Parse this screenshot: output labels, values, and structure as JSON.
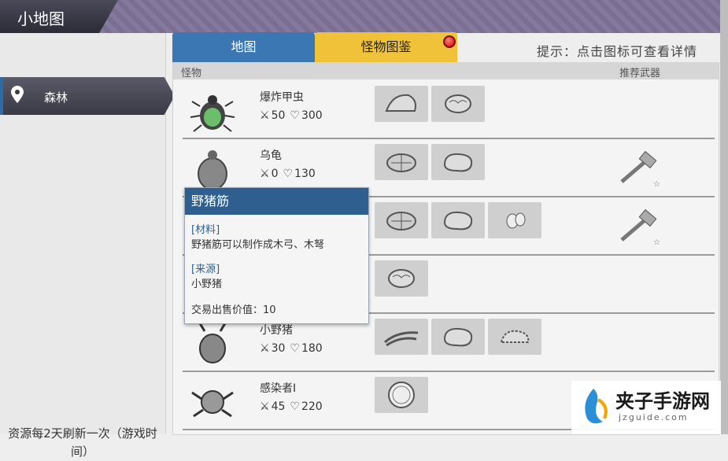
{
  "header": {
    "title": "小地图"
  },
  "left_panel": {
    "location": "森林",
    "refresh_note": "资源每2天刷新一次（游戏时间）"
  },
  "tabs": [
    {
      "label": "地图"
    },
    {
      "label": "怪物图鉴"
    }
  ],
  "hint": "提示：点击图标可查看详情",
  "table": {
    "col_monster": "怪物",
    "col_weapon": "推荐武器",
    "rows": [
      {
        "name": "爆炸甲虫",
        "attack": "50",
        "hp": "300"
      },
      {
        "name": "乌龟",
        "attack": "0",
        "hp": "130"
      },
      {
        "name": "",
        "attack": "",
        "hp": ""
      },
      {
        "name": "",
        "attack": "",
        "hp": ""
      },
      {
        "name": "小野猪",
        "attack": "30",
        "hp": "180"
      },
      {
        "name": "感染者I",
        "attack": "45",
        "hp": "220"
      }
    ]
  },
  "tooltip": {
    "title": "野猪筋",
    "cat1": "[材料]",
    "text1": "野猪筋可以制作成木弓、木弩",
    "cat2": "[来源]",
    "text2": "小野猪",
    "price": "交易出售价值：10"
  },
  "watermark": {
    "title": "夹子手游网",
    "url": "jzguide.com"
  },
  "colors": {
    "tab_active": "#f0c23a",
    "tab_inactive": "#3b78b3",
    "tooltip_header": "#2e5f8e"
  }
}
